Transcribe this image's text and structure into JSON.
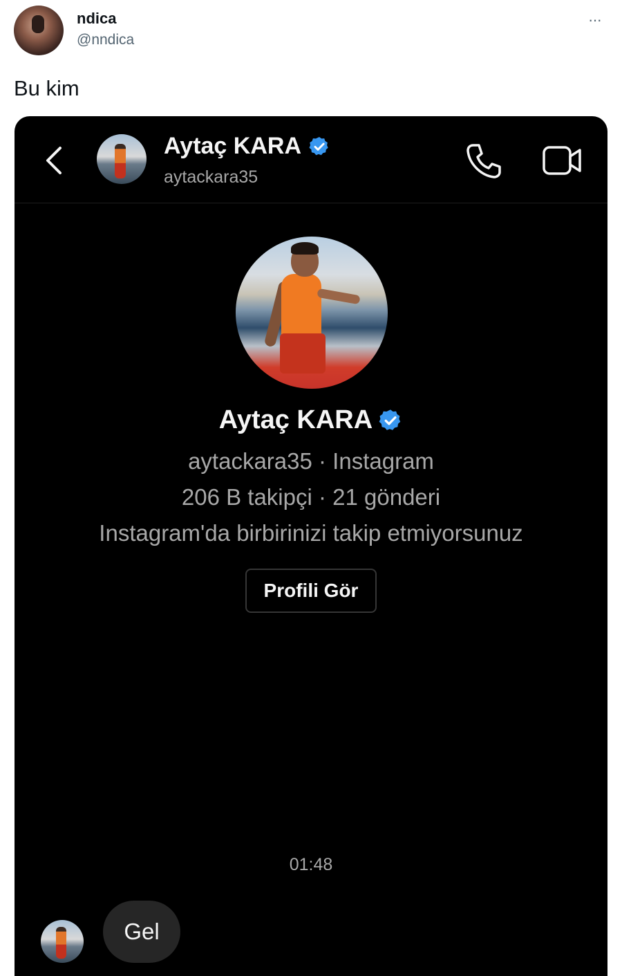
{
  "tweet": {
    "display_name": "ndica",
    "handle": "@nndica",
    "more": "···",
    "text": "Bu kim"
  },
  "instagram_dm": {
    "header": {
      "name": "Aytaç KARA",
      "username": "aytackara35",
      "verified": true
    },
    "profile": {
      "name": "Aytaç KARA",
      "source_line": "aytackara35 · Instagram",
      "stats_line": "206 B takipçi · 21 gönderi",
      "follow_status": "Instagram'da birbirinizi takip etmiyorsunuz",
      "view_profile_label": "Profili Gör"
    },
    "thread": {
      "timestamp": "01:48",
      "messages": [
        {
          "text": "Gel"
        }
      ]
    },
    "colors": {
      "verified_badge": "#3897f0",
      "background": "#000000",
      "bubble": "#262626"
    }
  }
}
